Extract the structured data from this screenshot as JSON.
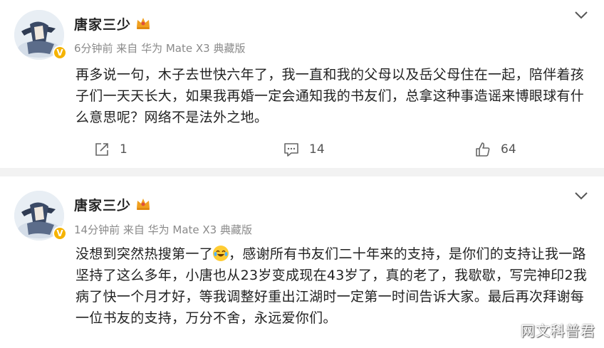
{
  "posts": [
    {
      "author": "唐家三少",
      "meta": "6分钟前  来自 华为 Mate X3 典藏版",
      "content": "再多说一句，木子去世快六年了，我一直和我的父母以及岳父母住在一起，陪伴着孩子们一天天长大，如果我再婚一定会通知我的书友们，总拿这种事造谣来博眼球有什么意思呢？网络不是法外之地。",
      "repost_count": "1",
      "comment_count": "14",
      "like_count": "64"
    },
    {
      "author": "唐家三少",
      "meta": "14分钟前  来自 华为 Mate X3 典藏版",
      "content_before_emoji": "没想到突然热搜第一了",
      "content_after_emoji": "，感谢所有书友们二十年来的支持，是你们的支持让我一路坚持了这么多年，小唐也从23岁变成现在43岁了，真的老了，我歇歇，写完神印2我病了快一个月才好，等我调整好重出江湖时一定第一时间告诉大家。最后再次拜谢每一位书友的支持，万分不舍，永远爱你们。"
    }
  ],
  "verified_mark": "V",
  "watermark": "网文科普君",
  "icons": {
    "verified": "verified-badge-icon",
    "crown": "crown-icon",
    "more": "chevron-down-icon",
    "repost": "repost-icon",
    "comment": "comment-icon",
    "like": "like-icon",
    "emoji": "laugh-cry-emoji-icon"
  },
  "colors": {
    "background": "#f2f2f2",
    "card": "#ffffff",
    "meta": "#8a8a8a",
    "verified": "#f5b300",
    "crown": "#f0a020"
  }
}
